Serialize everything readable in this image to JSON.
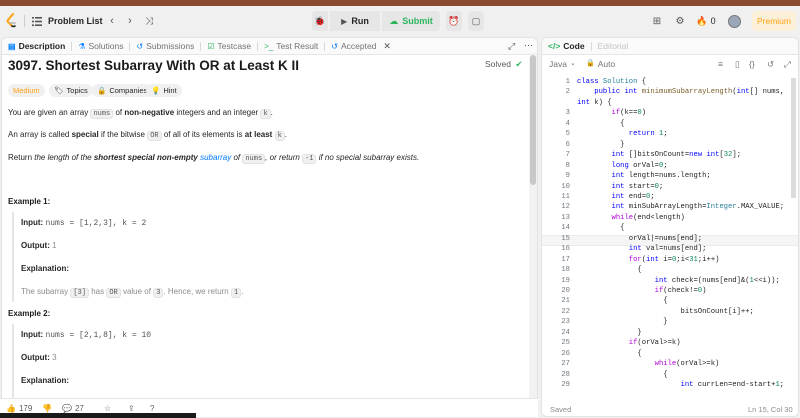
{
  "navbar": {
    "problem_list": "Problem List",
    "run": "Run",
    "submit": "Submit",
    "fire_count": "0",
    "premium": "Premium"
  },
  "left_tabs": [
    {
      "label": "Description",
      "icon": "document-icon"
    },
    {
      "label": "Solutions",
      "icon": "flask-icon"
    },
    {
      "label": "Submissions",
      "icon": "history-icon"
    },
    {
      "label": "Testcase",
      "icon": "checkbox-icon"
    },
    {
      "label": "Test Result",
      "icon": "terminal-icon"
    },
    {
      "label": "Accepted",
      "icon": "history-icon"
    }
  ],
  "problem": {
    "title": "3097. Shortest Subarray With OR at Least K II",
    "status": "Solved",
    "difficulty": "Medium",
    "chips": [
      "Topics",
      "Companies",
      "Hint"
    ],
    "p1_a": "You are given an array ",
    "p1_code1": "nums",
    "p1_b": " of ",
    "p1_bold": "non-negative",
    "p1_c": " integers and an integer ",
    "p1_code2": "k",
    "p1_d": ".",
    "p2_a": "An array is called ",
    "p2_bold1": "special",
    "p2_b": " if the bitwise ",
    "p2_code": "OR",
    "p2_c": " of all of its elements is ",
    "p2_bold2": "at least",
    "p2_d": " ",
    "p2_code2": "k",
    "p2_e": ".",
    "p3_a": "Return ",
    "p3_i1": "the length of the ",
    "p3_bold": "shortest special non-empty",
    "p3_link": "subarray",
    "p3_i2": " of ",
    "p3_code": "nums",
    "p3_i3": ", or return ",
    "p3_code2": "-1",
    "p3_i4": " if no special subarray exists.",
    "examples": [
      {
        "heading": "Example 1:",
        "input_label": "Input:",
        "input": "nums = [1,2,3], k = 2",
        "output_label": "Output:",
        "output": "1",
        "expl_label": "Explanation:",
        "expl_a": "The subarray ",
        "expl_code1": "[3]",
        "expl_b": " has ",
        "expl_code2": "OR",
        "expl_c": " value of ",
        "expl_code3": "3",
        "expl_d": ". Hence, we return ",
        "expl_code4": "1",
        "expl_e": "."
      },
      {
        "heading": "Example 2:",
        "input_label": "Input:",
        "input": "nums = [2,1,8], k = 10",
        "output_label": "Output:",
        "output": "3",
        "expl_label": "Explanation:"
      }
    ]
  },
  "footer": {
    "likes": "179",
    "comments": "27"
  },
  "code_panel": {
    "tab_code": "Code",
    "tab_editorial": "Editorial",
    "language": "Java",
    "auto": "Auto",
    "saved": "Saved",
    "cursor": "Ln 15, Col 30",
    "highlight_line": 15,
    "lines": [
      {
        "n": "1",
        "t": "class Solution {"
      },
      {
        "n": "2",
        "t": "    public int minimumSubarrayLength(int[] nums,"
      },
      {
        "n": "",
        "t": "int k) {"
      },
      {
        "n": "3",
        "t": "        if(k==0)"
      },
      {
        "n": "4",
        "t": "          {"
      },
      {
        "n": "5",
        "t": "            return 1;"
      },
      {
        "n": "6",
        "t": "          }"
      },
      {
        "n": "7",
        "t": "        int []bitsOnCount=new int[32];"
      },
      {
        "n": "8",
        "t": "        long orVal=0;"
      },
      {
        "n": "9",
        "t": "        int length=nums.length;"
      },
      {
        "n": "10",
        "t": "        int start=0;"
      },
      {
        "n": "11",
        "t": "        int end=0;"
      },
      {
        "n": "12",
        "t": "        int minSubArrayLength=Integer.MAX_VALUE;"
      },
      {
        "n": "13",
        "t": "        while(end<length)"
      },
      {
        "n": "14",
        "t": "          {"
      },
      {
        "n": "15",
        "t": "            orVal|=nums[end];"
      },
      {
        "n": "16",
        "t": "            int val=nums[end];"
      },
      {
        "n": "17",
        "t": "            for(int i=0;i<31;i++)"
      },
      {
        "n": "18",
        "t": "              {"
      },
      {
        "n": "19",
        "t": "                  int check=(nums[end]&(1<<i));"
      },
      {
        "n": "20",
        "t": "                  if(check!=0)"
      },
      {
        "n": "21",
        "t": "                    {"
      },
      {
        "n": "22",
        "t": "                        bitsOnCount[i]++;"
      },
      {
        "n": "23",
        "t": "                    }"
      },
      {
        "n": "24",
        "t": "              }"
      },
      {
        "n": "25",
        "t": "            if(orVal>=k)"
      },
      {
        "n": "26",
        "t": "              {"
      },
      {
        "n": "27",
        "t": "                  while(orVal>=k)"
      },
      {
        "n": "28",
        "t": "                    {"
      },
      {
        "n": "29",
        "t": "                        int currLen=end-start+1;"
      }
    ]
  }
}
